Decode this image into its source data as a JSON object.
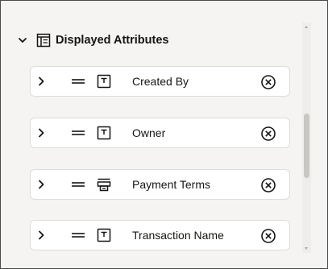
{
  "section": {
    "title": "Displayed Attributes",
    "expanded": true,
    "icon": "table-layout-icon"
  },
  "attributes": [
    {
      "label": "Created By",
      "icon": "text-field-icon"
    },
    {
      "label": "Owner",
      "icon": "text-field-icon"
    },
    {
      "label": "Payment Terms",
      "icon": "select-field-icon"
    },
    {
      "label": "Transaction Name",
      "icon": "text-field-icon"
    }
  ],
  "colors": {
    "panel_background": "#f5f4f2",
    "row_background": "#ffffff",
    "row_border": "#dedcd8",
    "text": "#161513",
    "scrollbar_thumb": "#c9c7c3"
  }
}
